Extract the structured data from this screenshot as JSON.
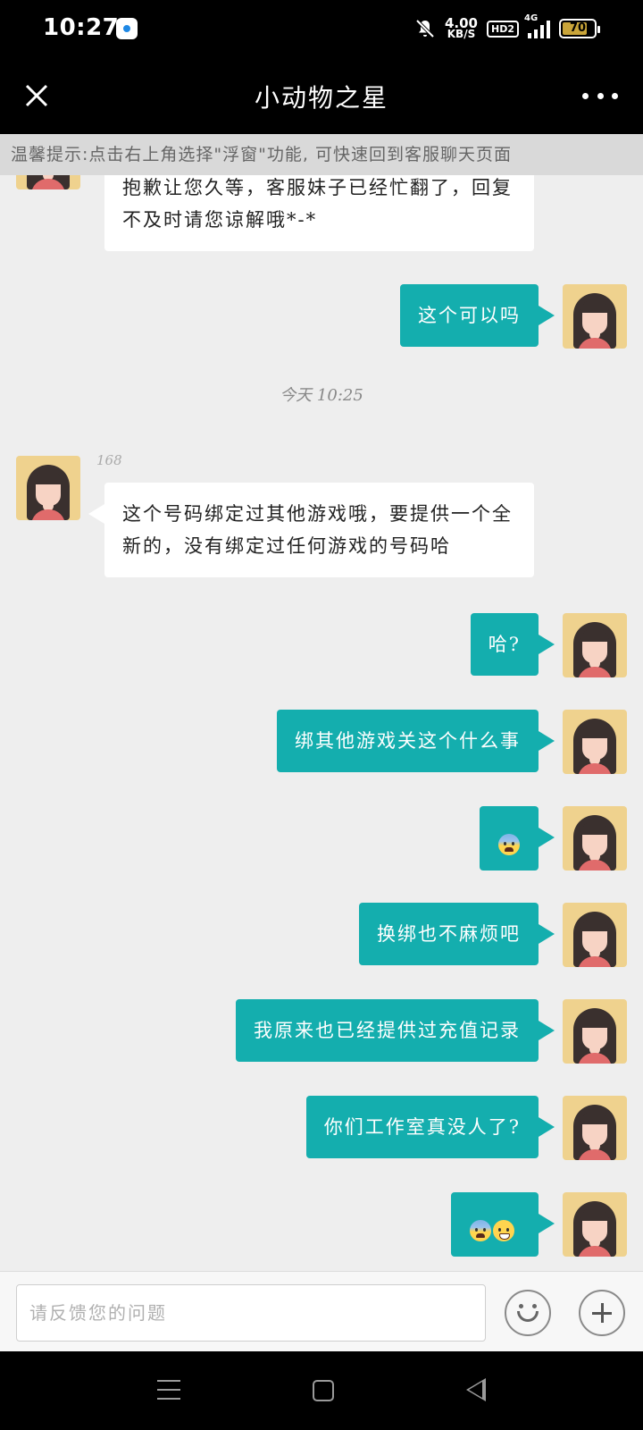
{
  "status_bar": {
    "time": "10:27",
    "net_speed_value": "4.00",
    "net_speed_unit": "KB/S",
    "hd_badge": "HD2",
    "network": "4G",
    "battery_level": "70"
  },
  "header": {
    "title": "小动物之星"
  },
  "notice": {
    "text": "温馨提示:点击右上角选择\"浮窗\"功能, 可快速回到客服聊天页面"
  },
  "messages": [
    {
      "direction": "in",
      "text": "抱歉让您久等，客服妹子已经忙翻了，回复不及时请您谅解哦*-*"
    },
    {
      "direction": "out",
      "text": "这个可以吗"
    },
    {
      "direction": "in",
      "text": "这个号码绑定过其他游戏哦，要提供一个全新的，没有绑定过任何游戏的号码哈"
    },
    {
      "direction": "out",
      "text": "哈?"
    },
    {
      "direction": "out",
      "text": "绑其他游戏关这个什么事"
    },
    {
      "direction": "out",
      "emoji": "fearful-face"
    },
    {
      "direction": "out",
      "text": "换绑也不麻烦吧"
    },
    {
      "direction": "out",
      "text": "我原来也已经提供过充值记录"
    },
    {
      "direction": "out",
      "text": "你们工作室真没人了?"
    },
    {
      "direction": "out",
      "emoji": "fearful-face, grinning-sweat-face"
    }
  ],
  "timestamp": "今天 10:25",
  "sender_name": "168",
  "input": {
    "placeholder": "请反馈您的问题"
  },
  "colors": {
    "outgoing_bubble": "#14aeae",
    "incoming_bubble": "#ffffff",
    "chat_background": "#eeeeee",
    "avatar_background": "#efd28e"
  }
}
